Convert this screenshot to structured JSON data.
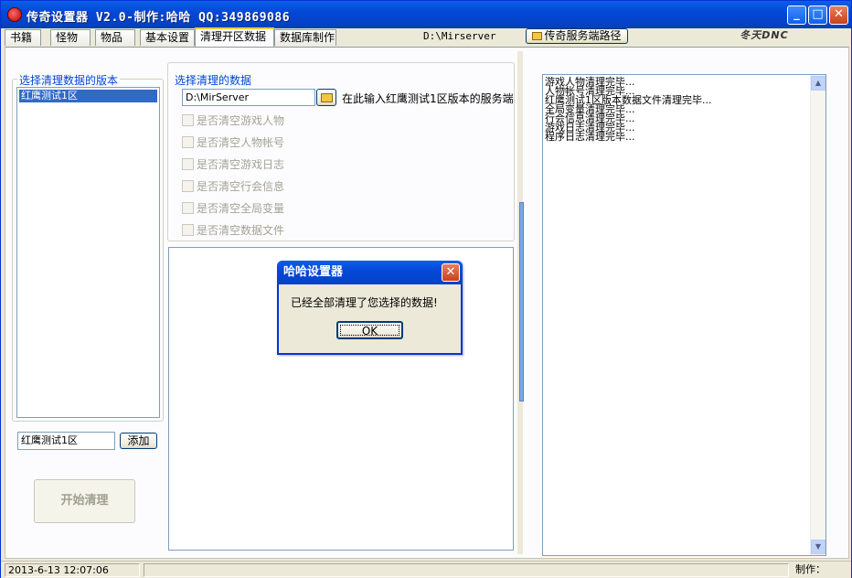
{
  "window": {
    "title": "传奇设置器 V2.0-制作:哈哈 QQ:349869086",
    "minimize_label": "_",
    "maximize_label": "□",
    "close_label": "✕"
  },
  "tabs": [
    {
      "label": "书籍"
    },
    {
      "label": "怪物"
    },
    {
      "label": "物品"
    },
    {
      "label": "基本设置"
    },
    {
      "label": "清理开区数据"
    },
    {
      "label": "数据库制作"
    }
  ],
  "toolbar": {
    "server_path": "D:\\Mirserver",
    "path_button_label": "传奇服务端路径",
    "logo_text": "冬天DNC"
  },
  "left_panel": {
    "group_label": "选择清理数据的版本",
    "versions": [
      "红鹰测试1区"
    ],
    "new_version_value": "红鹰测试1区",
    "add_button_label": "添加",
    "start_button_label": "开始清理"
  },
  "middle_panel": {
    "group_label": "选择清理的数据",
    "path_value": "D:\\MirServer",
    "path_hint": "在此输入红鹰测试1区版本的服务端",
    "options": [
      {
        "label": "是否清空游戏人物",
        "checked": false
      },
      {
        "label": "是否清空人物帐号",
        "checked": false
      },
      {
        "label": "是否清空游戏日志",
        "checked": false
      },
      {
        "label": "是否清空行会信息",
        "checked": false
      },
      {
        "label": "是否清空全局变量",
        "checked": false
      },
      {
        "label": "是否清空数据文件",
        "checked": false
      }
    ]
  },
  "log": {
    "lines": [
      "游戏人物清理完毕...",
      "人物帐号清理完毕...",
      "红鹰测试1区版本数据文件清理完毕...",
      "全局变量清理完毕...",
      "行会信息清理完毕...",
      "游戏日志清理完毕...",
      "程序日志清理完毕..."
    ]
  },
  "dialog": {
    "title": "哈哈设置器",
    "message": "已经全部清理了您选择的数据!",
    "ok_label": "OK"
  },
  "statusbar": {
    "datetime": "2013-6-13 12:07:06",
    "author_label": "制作："
  },
  "icons": {
    "folder": "folder-icon",
    "app": "app-icon"
  }
}
